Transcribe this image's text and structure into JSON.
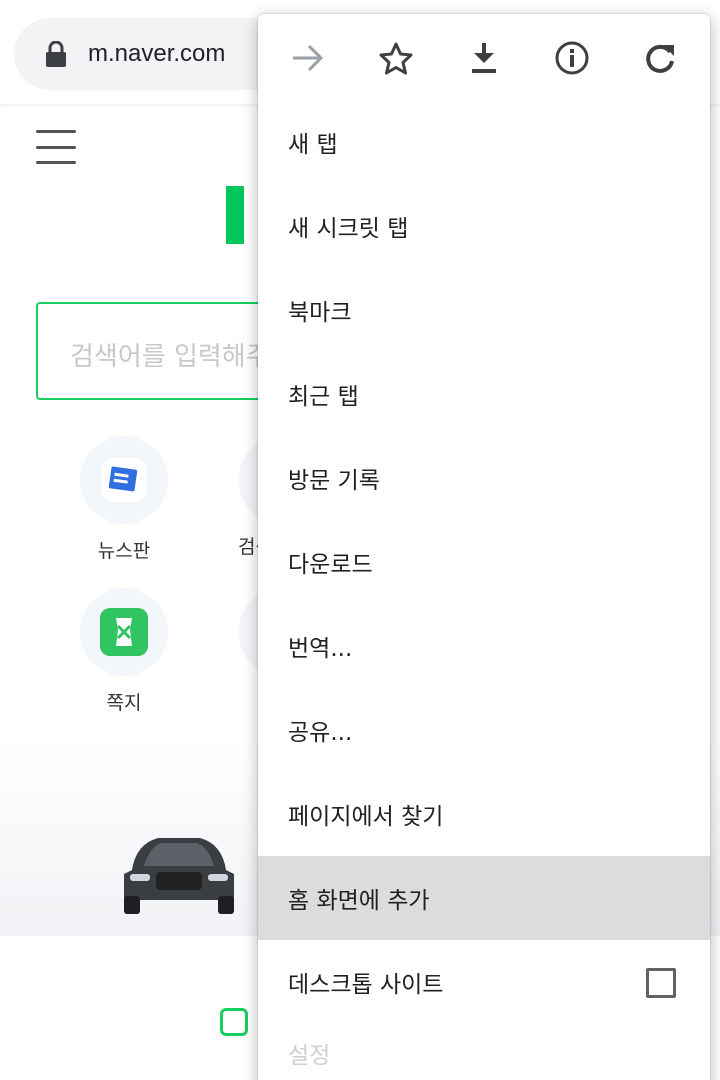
{
  "browser": {
    "url": "m.naver.com"
  },
  "page": {
    "search_placeholder": "검색어를 입력해주세요",
    "shortcuts": [
      {
        "label": "뉴스판"
      },
      {
        "label": "검색"
      },
      {
        "label": "쪽지"
      }
    ]
  },
  "menu": {
    "icons": [
      "forward-icon",
      "bookmark-star-icon",
      "download-icon",
      "info-icon",
      "reload-icon"
    ],
    "items": [
      {
        "label": "새 탭"
      },
      {
        "label": "새 시크릿 탭"
      },
      {
        "label": "북마크"
      },
      {
        "label": "최근 탭"
      },
      {
        "label": "방문 기록"
      },
      {
        "label": "다운로드"
      },
      {
        "label": "번역..."
      },
      {
        "label": "공유..."
      },
      {
        "label": "페이지에서 찾기"
      },
      {
        "label": "홈 화면에 추가"
      },
      {
        "label": "데스크톱 사이트"
      },
      {
        "label": "설정"
      }
    ],
    "highlighted_item": "홈 화면에 추가",
    "desktop_site_checked": false
  },
  "colors": {
    "naver_green": "#03c75a",
    "menu_highlight": "#dcdcdc"
  }
}
